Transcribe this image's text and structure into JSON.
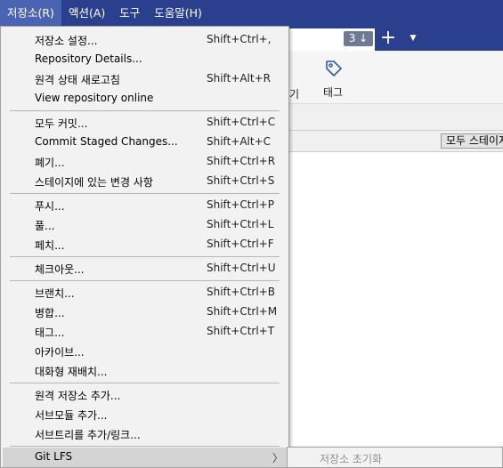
{
  "menubar": {
    "items": [
      "저장소(R)",
      "액션(A)",
      "도구",
      "도움말(H)"
    ]
  },
  "background": {
    "tab_count": "3 ↓",
    "add_tab": "+",
    "tab_menu": "▼",
    "toolbar_partial_label": "기",
    "toolbar_tag_label": "태그",
    "stage_all_button": "모두 스테이지"
  },
  "menu": {
    "items": [
      {
        "label": "저장소 설정...",
        "shortcut": "Shift+Ctrl+,"
      },
      {
        "label": "Repository Details...",
        "shortcut": ""
      },
      {
        "label": "원격 상태 새로고침",
        "shortcut": "Shift+Alt+R"
      },
      {
        "label": "View repository online",
        "shortcut": ""
      },
      {
        "label": "모두 커밋...",
        "shortcut": "Shift+Ctrl+C"
      },
      {
        "label": "Commit Staged Changes...",
        "shortcut": "Shift+Alt+C"
      },
      {
        "label": "폐기...",
        "shortcut": "Shift+Ctrl+R"
      },
      {
        "label": "스테이지에 있는 변경 사항",
        "shortcut": "Shift+Ctrl+S"
      },
      {
        "label": "푸시...",
        "shortcut": "Shift+Ctrl+P"
      },
      {
        "label": "풀...",
        "shortcut": "Shift+Ctrl+L"
      },
      {
        "label": "페치...",
        "shortcut": "Shift+Ctrl+F"
      },
      {
        "label": "체크아웃...",
        "shortcut": "Shift+Ctrl+U"
      },
      {
        "label": "브랜치...",
        "shortcut": "Shift+Ctrl+B"
      },
      {
        "label": "병합...",
        "shortcut": "Shift+Ctrl+M"
      },
      {
        "label": "태그...",
        "shortcut": "Shift+Ctrl+T"
      },
      {
        "label": "아카이브...",
        "shortcut": ""
      },
      {
        "label": "대화형 재배치...",
        "shortcut": ""
      },
      {
        "label": "원격 저장소 추가...",
        "shortcut": ""
      },
      {
        "label": "서브모듈 추가...",
        "shortcut": ""
      },
      {
        "label": "서브트리를 추가/링크...",
        "shortcut": ""
      },
      {
        "label": "Git LFS",
        "shortcut": "",
        "submenu_arrow": "〉"
      }
    ]
  },
  "submenu": {
    "items": [
      {
        "label": "저장소 초기화"
      }
    ]
  }
}
